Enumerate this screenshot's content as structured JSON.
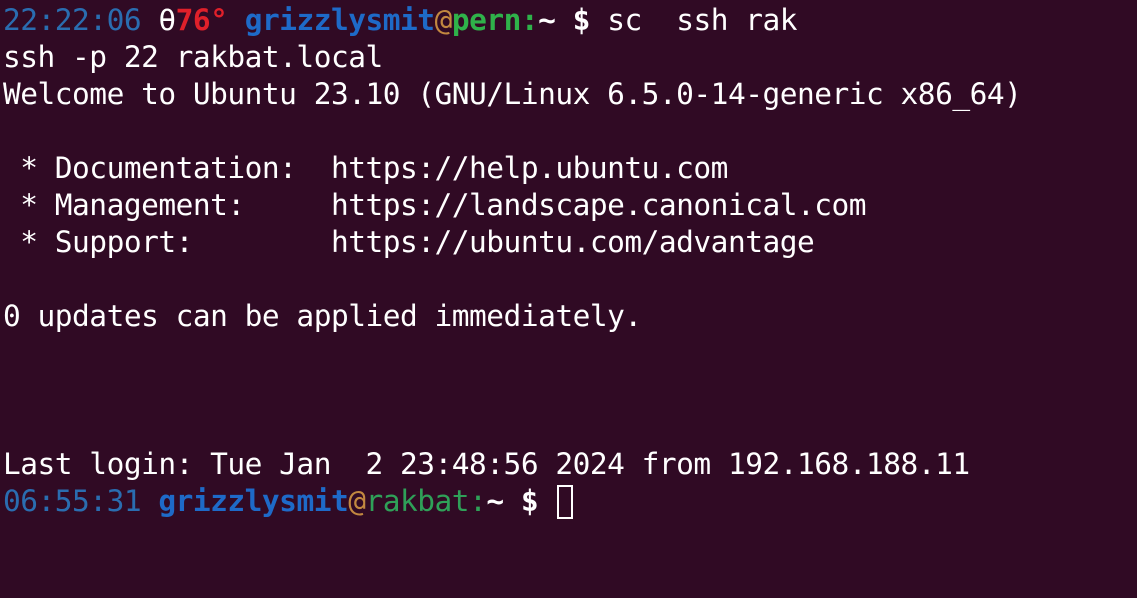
{
  "prompt1": {
    "time": "22:22:06",
    "theta": "θ",
    "temperature": "76°",
    "user": "grizzlysmit",
    "at": "@",
    "host": "pern",
    "colon": ":",
    "path": "~",
    "symbol": "$",
    "command": "sc  ssh rak"
  },
  "output": {
    "ssh_command": "ssh -p 22 rakbat.local",
    "welcome": "Welcome to Ubuntu 23.10 (GNU/Linux 6.5.0-14-generic x86_64)",
    "doc_line": " * Documentation:  https://help.ubuntu.com",
    "mgmt_line": " * Management:     https://landscape.canonical.com",
    "support_line": " * Support:        https://ubuntu.com/advantage",
    "updates": "0 updates can be applied immediately.",
    "last_login": "Last login: Tue Jan  2 23:48:56 2024 from 192.168.188.11"
  },
  "prompt2": {
    "time": "06:55:31",
    "user": "grizzlysmit",
    "at": "@",
    "host": "rakbat",
    "colon": ":",
    "path": "~",
    "symbol": "$"
  },
  "colors": {
    "background": "#300a24",
    "foreground": "#ffffff",
    "time": "#2a6db0",
    "user": "#1e6ac8",
    "temperature": "#e0202a",
    "host_local": "#2fb24a",
    "host_remote": "#2fa058",
    "at": "#c28840"
  }
}
